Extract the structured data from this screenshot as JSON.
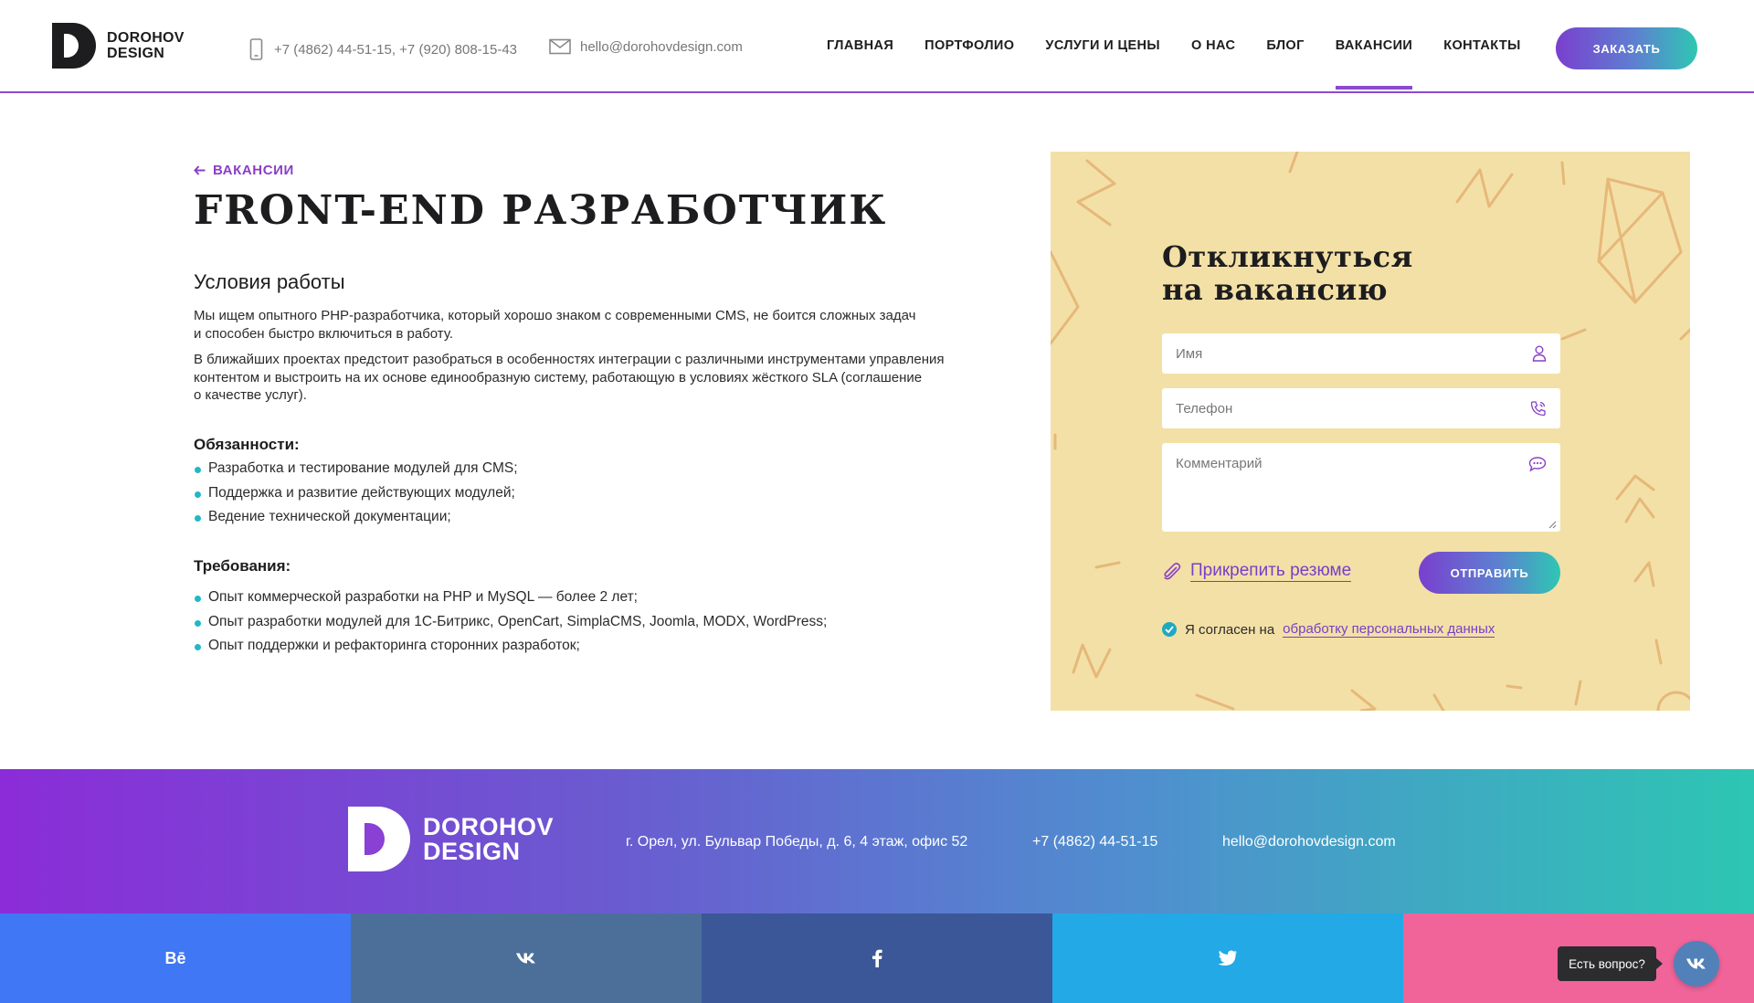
{
  "header": {
    "logo_line1": "DOROHOV",
    "logo_line2": "DESIGN",
    "phones": "+7 (4862) 44-51-15,  +7 (920) 808-15-43",
    "email": "hello@dorohovdesign.com",
    "nav": [
      "ГЛАВНАЯ",
      "ПОРТФОЛИО",
      "УСЛУГИ И ЦЕНЫ",
      "О НАС",
      "БЛОГ",
      "ВАКАНСИИ",
      "КОНТАКТЫ"
    ],
    "active_nav": "ВАКАНСИИ",
    "order_label": "ЗАКАЗАТЬ"
  },
  "main": {
    "back_label": "ВАКАНСИИ",
    "title": "FRONT-END РАЗРАБОТЧИК",
    "conditions_title": "Условия работы",
    "paragraph1_line1": "Мы ищем опытного PHP-разработчика, который хорошо знаком с современными CMS, не боится сложных задач",
    "paragraph1_line2": "и способен быстро включиться в работу.",
    "paragraph2_line1": "В ближайших проектах предстоит разобраться в особенностях интеграции с различными инструментами управления",
    "paragraph2_line2": "контентом и выстроить на их основе единообразную систему, работающую в условиях жёсткого SLA (соглашение",
    "paragraph2_line3": "о качестве услуг).",
    "duties_title": "Обязанности:",
    "duties": [
      "Разработка и тестирование модулей для CMS;",
      "Поддержка и развитие действующих модулей;",
      "Ведение технической документации;"
    ],
    "requirements_title": "Требования:",
    "requirements": [
      "Опыт коммерческой разработки на PHP и MySQL — более 2 лет;",
      "Опыт разработки модулей для 1С-Битрикс, OpenCart, SimplaCMS, Joomla, MODX, WordPress;",
      "Опыт поддержки и рефакторинга сторонних разработок;"
    ]
  },
  "form": {
    "title_line1": "Откликнуться",
    "title_line2": "на вакансию",
    "name_placeholder": "Имя",
    "phone_placeholder": "Телефон",
    "comment_placeholder": "Комментарий",
    "attach_label": "Прикрепить резюме",
    "submit_label": "ОТПРАВИТЬ",
    "consent_prefix": "Я согласен на",
    "consent_link": "обработку персональных данных",
    "consent_checked": true
  },
  "footer": {
    "logo_line1": "DOROHOV",
    "logo_line2": "DESIGN",
    "address": "г. Орел, ул. Бульвар Победы, д. 6, 4 этаж, офис 52",
    "phone": "+7 (4862) 44-51-15",
    "email": "hello@dorohovdesign.com"
  },
  "social": [
    {
      "name": "behance",
      "label": "Bē",
      "color": "#3f77f4"
    },
    {
      "name": "vk",
      "label": "vk",
      "color": "#4c6f9a"
    },
    {
      "name": "facebook",
      "label": "f",
      "color": "#3b5797"
    },
    {
      "name": "twitter",
      "label": "twitter",
      "color": "#22a9e6"
    },
    {
      "name": "instagram",
      "label": "instagram",
      "color": "#f0649a"
    }
  ],
  "chat": {
    "tooltip": "Есть вопрос?",
    "button_label": "vk"
  },
  "colors": {
    "accent": "#8a3fc7",
    "gradient_start": "#7a3fcf",
    "gradient_end": "#2ec7b3",
    "panel_bg": "#f3e0a6",
    "bullet": "#22b7c6"
  }
}
